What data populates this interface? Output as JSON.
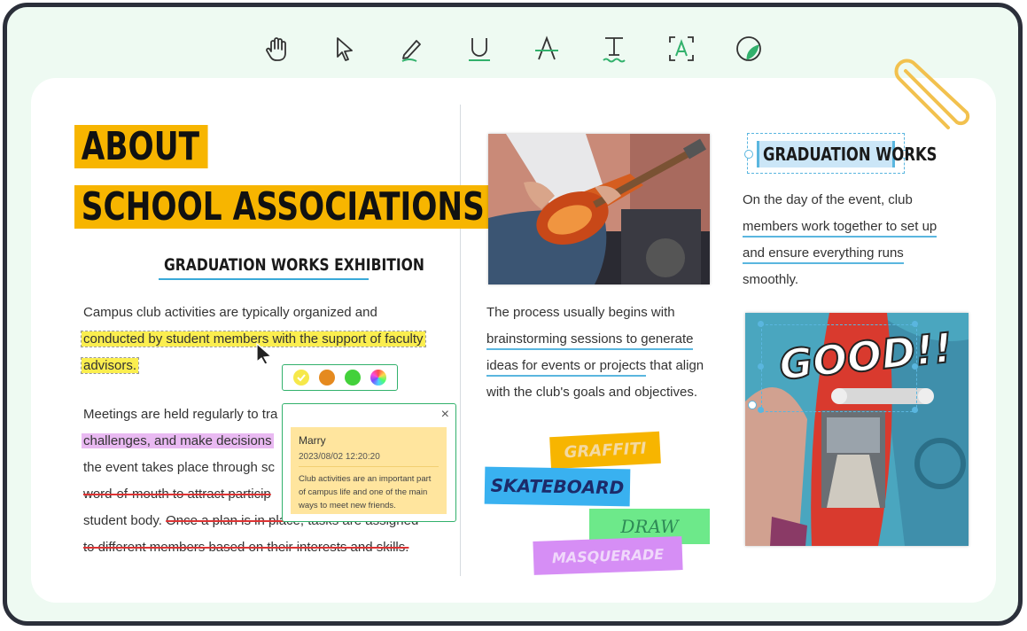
{
  "toolbar": {
    "tools": [
      "hand-icon",
      "select-cursor-icon",
      "pen-icon",
      "underline-icon",
      "strikethrough-icon",
      "text-icon",
      "area-text-icon",
      "shape-icon"
    ],
    "accent": "#32b16c"
  },
  "left": {
    "title_line1": "ABOUT",
    "title_line2": "SCHOOL ASSOCIATIONS",
    "subtitle": "GRADUATION WORKS EXHIBITION",
    "p1_line1": "Campus club activities are typically organized and",
    "p1_line2": "conducted by student members with the support of faculty",
    "p1_line3": "advisors.",
    "p2_line1": "Meetings are held regularly to tra",
    "p2_line2": "challenges, and make decisions",
    "p2_line3": "the event takes place through sc",
    "p2_line4": "word-of-mouth to attract particip",
    "p2_line5a": "student body. ",
    "p2_line5b": "Once a plan is in place, tasks are assigned",
    "p2_line6": "to different members based on their interests and skills."
  },
  "color_picker": {
    "colors": [
      "#f6e84a",
      "#e58a1f",
      "#43d13b",
      "rainbow"
    ]
  },
  "comment": {
    "author": "Marry",
    "timestamp": "2023/08/02 12:20:20",
    "text": "Club activities are an important part of campus life and one of the main ways to meet new friends.",
    "close": "×"
  },
  "middle": {
    "p1_line1": "The process usually begins with",
    "p1_line2": "brainstorming sessions to generate",
    "p1_line3a": "ideas for events or projects",
    "p1_line3b": " that align",
    "p1_line4": "with the club's goals and objectives.",
    "stickers": {
      "graffiti": "GRAFFITI",
      "skateboard": "SKATEBOARD",
      "draw": "DRAW",
      "masquerade": "MASQUERADE"
    }
  },
  "right": {
    "heading": "GRADUATION WORKS",
    "line1": "On the day of the event, club",
    "line2": "members work together to set up",
    "line3": "and ensure everything runs",
    "line4": "smoothly.",
    "photo_overlay": "GOOD!!"
  }
}
